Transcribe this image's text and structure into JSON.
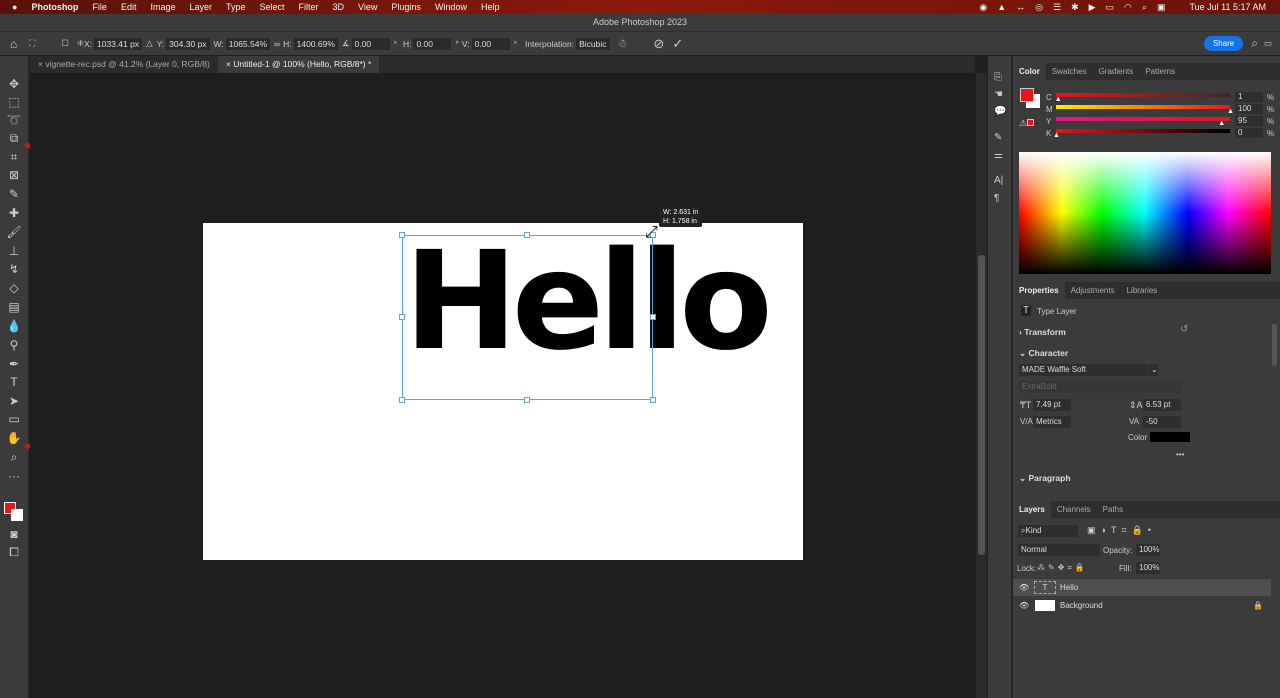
{
  "menubar": {
    "apple": "",
    "app": "Photoshop",
    "items": [
      "File",
      "Edit",
      "Image",
      "Layer",
      "Type",
      "Select",
      "Filter",
      "3D",
      "View",
      "Plugins",
      "Window",
      "Help"
    ],
    "clock": "Tue Jul 11  5:17 AM"
  },
  "window_title": "Adobe Photoshop 2023",
  "options": {
    "x_label": "X:",
    "x": "1033.41 px",
    "y_label": "Y:",
    "y": "304.30 px",
    "w_label": "W:",
    "w": "1065.54%",
    "h_label": "H:",
    "h": "1400.69%",
    "angle": "0.00",
    "deg": "°",
    "hskew_label": "H:",
    "hskew": "0.00",
    "vskew_label": "V:",
    "vskew": "0.00",
    "interp_label": "Interpolation:",
    "interp": "Bicubic",
    "share": "Share"
  },
  "tabs": [
    {
      "label": "vignette-rec.psd @ 41.2% (Layer 0, RGB/8)"
    },
    {
      "label": "Untitled-1 @ 100% (Hello, RGB/8*) *"
    }
  ],
  "canvas": {
    "text": "Hello",
    "tooltip_w": "W: 2.631 in",
    "tooltip_h": "H: 1.758 in"
  },
  "color_panel": {
    "tabs": [
      "Color",
      "Swatches",
      "Gradients",
      "Patterns"
    ],
    "channels": [
      {
        "label": "C",
        "value": "1",
        "pct": "%",
        "fraction": 0.01
      },
      {
        "label": "M",
        "value": "100",
        "pct": "%",
        "fraction": 1.0
      },
      {
        "label": "Y",
        "value": "95",
        "pct": "%",
        "fraction": 0.95
      },
      {
        "label": "K",
        "value": "0",
        "pct": "%",
        "fraction": 0
      }
    ],
    "foreground": "#e8141b",
    "background": "#ffffff"
  },
  "properties": {
    "tabs": [
      "Properties",
      "Adjustments",
      "Libraries"
    ],
    "layer_type": "Type Layer",
    "transform": "Transform",
    "character": "Character",
    "font": "MADE Waffle Soft",
    "style": "ExtraBold",
    "size": "7.49 pt",
    "leading": "6.53 pt",
    "kerning": "Metrics",
    "tracking": "-50",
    "color_label": "Color",
    "more": "•••",
    "paragraph": "Paragraph"
  },
  "layers": {
    "tabs": [
      "Layers",
      "Channels",
      "Paths"
    ],
    "kind": "Kind",
    "blend": "Normal",
    "opacity_label": "Opacity:",
    "opacity": "100%",
    "lock_label": "Lock:",
    "fill_label": "Fill:",
    "fill": "100%",
    "items": [
      {
        "name": "Hello"
      },
      {
        "name": "Background"
      }
    ]
  }
}
